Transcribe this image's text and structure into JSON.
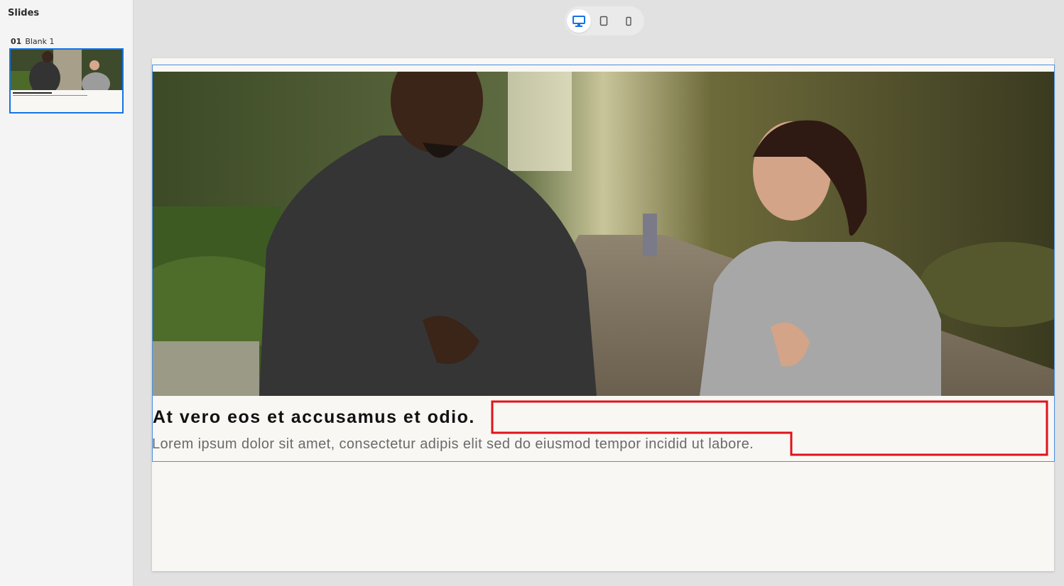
{
  "sidebar": {
    "title": "Slides",
    "slides": [
      {
        "number": "01",
        "name": "Blank 1",
        "selected": true
      }
    ]
  },
  "device_toggle": {
    "options": [
      {
        "icon": "desktop-icon",
        "active": true
      },
      {
        "icon": "tablet-icon",
        "active": false
      },
      {
        "icon": "mobile-icon",
        "active": false
      }
    ]
  },
  "slide": {
    "heading": "At vero eos et accusamus et odio.",
    "body": "Lorem ipsum dolor sit amet, consectetur adipis elit sed do eiusmod tempor incidid ut labore."
  },
  "colors": {
    "accent": "#1473e6",
    "selection_outline": "#4a90e2",
    "highlight": "#e0121a"
  }
}
